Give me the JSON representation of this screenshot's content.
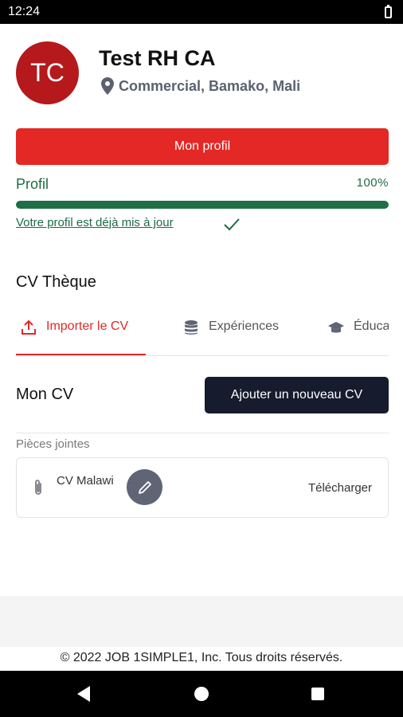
{
  "status_bar": {
    "time": "12:24"
  },
  "profile": {
    "initials": "TC",
    "name": "Test RH CA",
    "location": "Commercial, Bamako, Mali",
    "button_label": "Mon profil"
  },
  "progress": {
    "label": "Profil",
    "value_text": "100%",
    "value": 1.0,
    "status_text": "Votre profil est déjà mis à jour"
  },
  "cv_section": {
    "title": "CV Thèque",
    "tabs": [
      {
        "label": "Importer le CV",
        "icon": "upload-icon",
        "active": true
      },
      {
        "label": "Expériences",
        "icon": "database-icon",
        "active": false
      },
      {
        "label": "Éducation",
        "icon": "graduation-cap-icon",
        "active": false
      }
    ]
  },
  "my_cv": {
    "title": "Mon CV",
    "add_button": "Ajouter un nouveau CV",
    "attachments_label": "Pièces jointes",
    "attachments": [
      {
        "name": "CV Malawi",
        "download_label": "Télécharger",
        "icon": "paperclip-icon"
      }
    ]
  },
  "footer": {
    "copyright": "© 2022 JOB 1SIMPLE1, Inc. Tous droits réservés."
  },
  "colors": {
    "brand_red": "#e32826",
    "avatar_red": "#b5191c",
    "success_green": "#1f6e47",
    "dark_navy": "#161b2e"
  }
}
